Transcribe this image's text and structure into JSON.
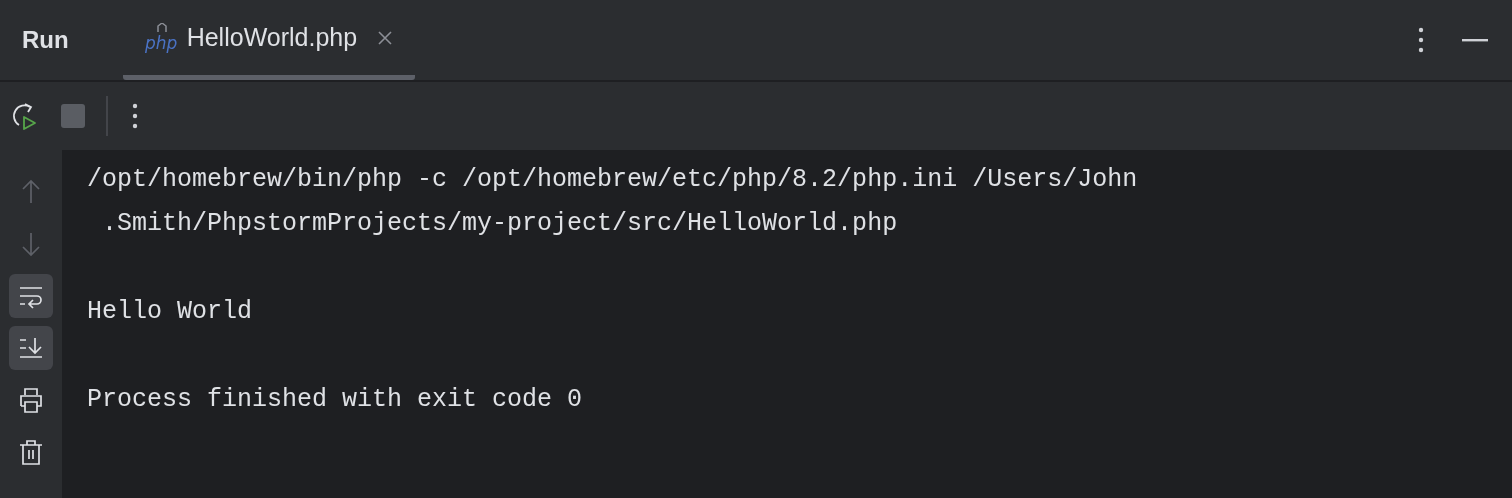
{
  "panel": {
    "title": "Run"
  },
  "tabs": [
    {
      "label": "HelloWorld.php",
      "icon_text": "php",
      "selected": true
    }
  ],
  "toolbar": [
    {
      "kind": "rerun",
      "disabled": false
    },
    {
      "kind": "stop",
      "disabled": true
    }
  ],
  "side_buttons": [
    {
      "kind": "up",
      "disabled": true,
      "on": false
    },
    {
      "kind": "down",
      "disabled": true,
      "on": false
    },
    {
      "kind": "wrap",
      "disabled": false,
      "on": true
    },
    {
      "kind": "scroll",
      "disabled": false,
      "on": true
    },
    {
      "kind": "print",
      "disabled": false,
      "on": false
    },
    {
      "kind": "trash",
      "disabled": false,
      "on": false
    }
  ],
  "console": {
    "blocks": [
      [
        "/opt/homebrew/bin/php -c /opt/homebrew/etc/php/8.2/php.ini /Users/John",
        " .Smith/PhpstormProjects/my-project/src/HelloWorld.php"
      ],
      [
        "Hello World"
      ],
      [
        "Process finished with exit code 0"
      ]
    ]
  }
}
